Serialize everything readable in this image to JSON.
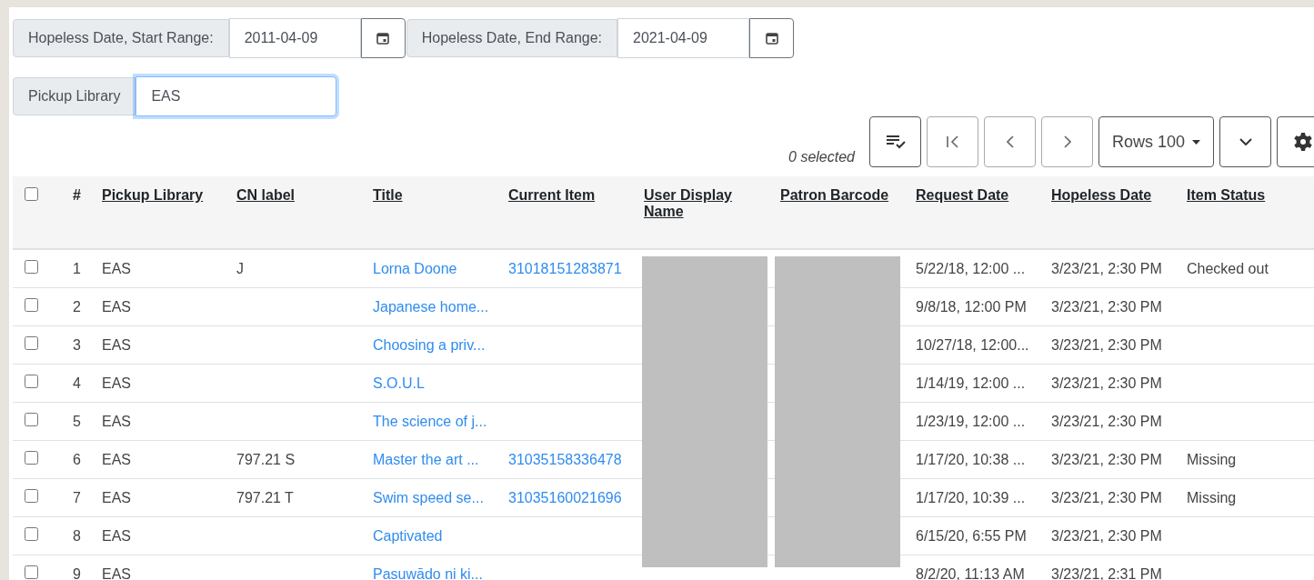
{
  "filters": [
    {
      "label": "Hopeless Date, Start Range:",
      "value": "2011-04-09"
    },
    {
      "label": "Hopeless Date, End Range:",
      "value": "2021-04-09"
    }
  ],
  "pickup_filter": {
    "label": "Pickup Library",
    "value": "EAS",
    "focused": true
  },
  "toolbar": {
    "selected_count": "0 selected",
    "rows_label": "Rows 100"
  },
  "table": {
    "all_checked": false,
    "columns": [
      {
        "label": "#",
        "sortable": false,
        "redacted": false
      },
      {
        "label": "Pickup Library",
        "sortable": true,
        "redacted": false
      },
      {
        "label": "CN label",
        "sortable": true,
        "redacted": false
      },
      {
        "label": "Title",
        "sortable": true,
        "redacted": false
      },
      {
        "label": "Current Item",
        "sortable": true,
        "redacted": false
      },
      {
        "label": "User Display Name",
        "sortable": true,
        "redacted": true
      },
      {
        "label": "Patron Barcode",
        "sortable": true,
        "redacted": true
      },
      {
        "label": "Request Date",
        "sortable": true,
        "redacted": false
      },
      {
        "label": "Hopeless Date",
        "sortable": true,
        "redacted": false
      },
      {
        "label": "Item Status",
        "sortable": true,
        "redacted": false
      }
    ],
    "rows": [
      {
        "checked": false,
        "num": "1",
        "library": "EAS",
        "cn": "J",
        "title": "Lorna Doone",
        "item": "31018151283871",
        "request": "5/22/18, 12:00 ...",
        "hopeless": "3/23/21, 2:30 PM",
        "status": "Checked out"
      },
      {
        "checked": false,
        "num": "2",
        "library": "EAS",
        "title": "Japanese home...",
        "request": "9/8/18, 12:00 PM",
        "hopeless": "3/23/21, 2:30 PM"
      },
      {
        "checked": false,
        "num": "3",
        "library": "EAS",
        "title": "Choosing a priv...",
        "request": "10/27/18, 12:00...",
        "hopeless": "3/23/21, 2:30 PM"
      },
      {
        "checked": false,
        "num": "4",
        "library": "EAS",
        "title": "S.O.U.L",
        "request": "1/14/19, 12:00 ...",
        "hopeless": "3/23/21, 2:30 PM"
      },
      {
        "checked": false,
        "num": "5",
        "library": "EAS",
        "title": "The science of j...",
        "request": "1/23/19, 12:00 ...",
        "hopeless": "3/23/21, 2:30 PM"
      },
      {
        "checked": false,
        "num": "6",
        "library": "EAS",
        "cn": "797.21 S",
        "title": "Master the art ...",
        "item": "31035158336478",
        "request": "1/17/20, 10:38 ...",
        "hopeless": "3/23/21, 2:30 PM",
        "status": "Missing"
      },
      {
        "checked": false,
        "num": "7",
        "library": "EAS",
        "cn": "797.21 T",
        "title": "Swim speed se...",
        "item": "31035160021696",
        "request": "1/17/20, 10:39 ...",
        "hopeless": "3/23/21, 2:30 PM",
        "status": "Missing"
      },
      {
        "checked": false,
        "num": "8",
        "library": "EAS",
        "title": "Captivated",
        "request": "6/15/20, 6:55 PM",
        "hopeless": "3/23/21, 2:30 PM"
      },
      {
        "checked": false,
        "num": "9",
        "library": "EAS",
        "title": "Pasuwādo ni ki...",
        "request": "8/2/20, 11:13 AM",
        "hopeless": "3/23/21, 2:31 PM"
      }
    ]
  }
}
